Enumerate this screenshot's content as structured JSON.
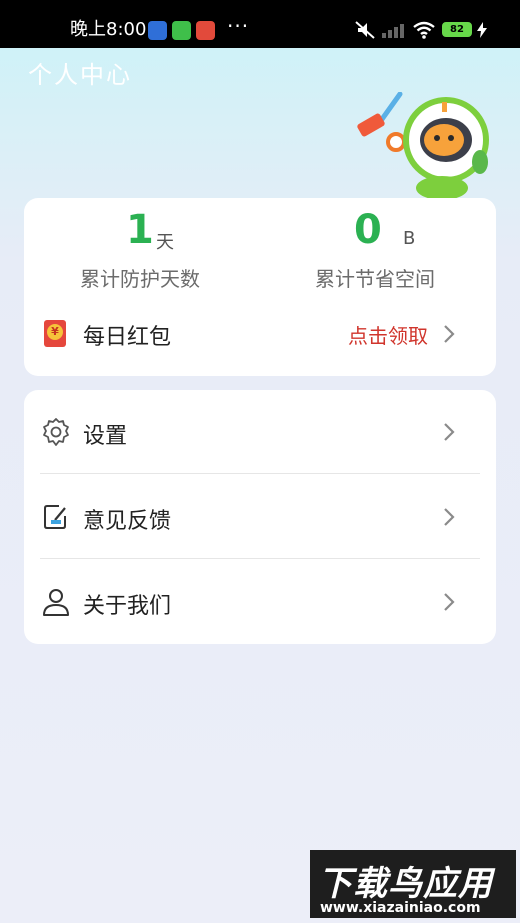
{
  "status_bar": {
    "time": "晚上8:00",
    "more": "···",
    "battery": "82"
  },
  "header": {
    "title": "个人中心"
  },
  "stats": {
    "protect_days": {
      "value": "1",
      "unit": "天",
      "label": "累计防护天数"
    },
    "saved_space": {
      "value": "0",
      "unit": "B",
      "label": "累计节省空间"
    }
  },
  "red_packet": {
    "icon_char": "¥",
    "label": "每日红包",
    "action": "点击领取"
  },
  "menu": {
    "items": [
      {
        "label": "设置",
        "icon": "gear-icon"
      },
      {
        "label": "意见反馈",
        "icon": "feedback-icon"
      },
      {
        "label": "关于我们",
        "icon": "user-icon"
      }
    ]
  },
  "watermark": {
    "title": "下载鸟应用",
    "url": "www.xiazainiao.com"
  },
  "colors": {
    "accent_green": "#2bb152",
    "red_text": "#d0352c"
  }
}
